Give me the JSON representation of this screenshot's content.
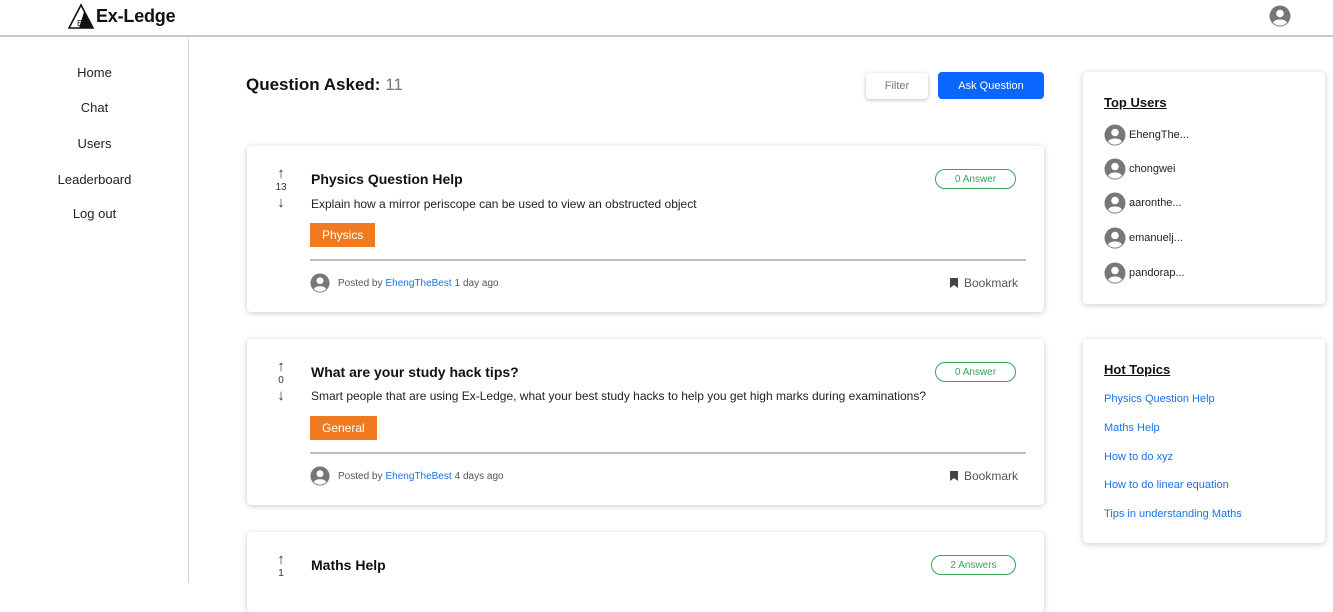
{
  "app": {
    "name": "Ex-Ledge",
    "logo_letter": "E",
    "accent": "#0a66ff",
    "tag_color": "#f07a22",
    "answer_color": "#3aa35a"
  },
  "header": {
    "profile_icon": "user-circle-icon"
  },
  "sidebar": {
    "items": [
      {
        "label": "Home"
      },
      {
        "label": "Chat"
      },
      {
        "label": "Users"
      },
      {
        "label": "Leaderboard"
      },
      {
        "label": "Log out"
      }
    ]
  },
  "main": {
    "title": "Question Asked:",
    "count": "11",
    "filter_label": "Filter",
    "ask_label": "Ask Question",
    "questions": [
      {
        "title": "Physics Question Help",
        "body": "Explain how a mirror periscope can be used to view an obstructed object",
        "votes": "13",
        "tag": "Physics",
        "answers": "0 Answer",
        "posted_by": "Posted by",
        "author": "EhengTheBest",
        "time": "1 day ago",
        "bookmark": "Bookmark"
      },
      {
        "title": "What are your study hack tips?",
        "body": "Smart people that are using Ex-Ledge, what your best study hacks to help you get high marks during examinations?",
        "votes": "0",
        "tag": "General",
        "answers": "0 Answer",
        "posted_by": "Posted by",
        "author": "EhengTheBest",
        "time": "4 days ago",
        "bookmark": "Bookmark"
      },
      {
        "title": "Maths Help",
        "votes": "1",
        "answers": "2 Answers"
      }
    ]
  },
  "top_users": {
    "title": "Top Users",
    "users": [
      "EhengThe...",
      "chongwei",
      "aaronthe...",
      "emanuelj...",
      "pandorap..."
    ]
  },
  "hot_topics": {
    "title": "Hot Topics",
    "topics": [
      "Physics Question Help",
      "Maths Help",
      "How to do xyz",
      "How to do linear equation",
      "Tips in understanding Maths"
    ]
  }
}
